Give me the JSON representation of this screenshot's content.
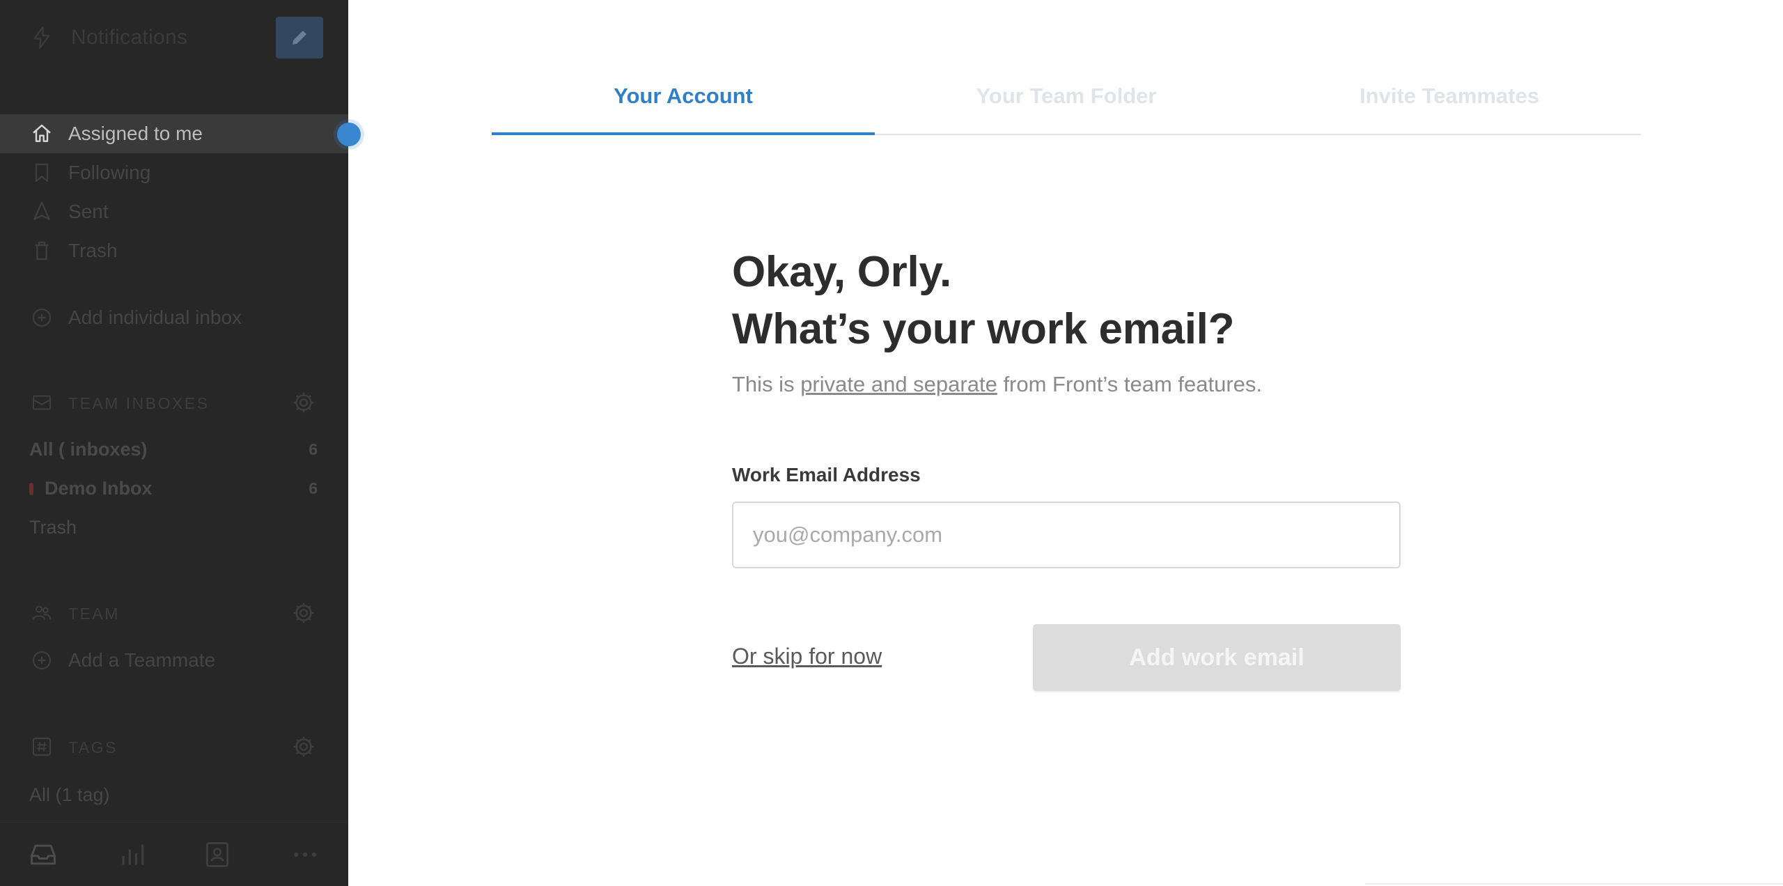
{
  "sidebar": {
    "header_title": "Notifications",
    "nav": [
      {
        "label": "Assigned to me",
        "icon": "home-icon",
        "active": true
      },
      {
        "label": "Following",
        "icon": "bookmark-icon",
        "active": false
      },
      {
        "label": "Sent",
        "icon": "send-icon",
        "active": false
      },
      {
        "label": "Trash",
        "icon": "trash-icon",
        "active": false
      }
    ],
    "add_inbox_label": "Add individual inbox",
    "team_inboxes": {
      "title": "TEAM INBOXES",
      "all_label": "All ( inboxes)",
      "all_count": "6",
      "demo_label": "Demo Inbox",
      "demo_count": "6",
      "trash_label": "Trash"
    },
    "team": {
      "title": "TEAM",
      "add_label": "Add a Teammate"
    },
    "tags": {
      "title": "TAGS",
      "all_label": "All (1 tag)"
    }
  },
  "tabs": [
    {
      "label": "Your Account",
      "active": true
    },
    {
      "label": "Your Team Folder",
      "active": false
    },
    {
      "label": "Invite Teammates",
      "active": false
    }
  ],
  "form": {
    "heading_line1": "Okay, Orly.",
    "heading_line2": "What’s your work email?",
    "sub_prefix": "This is ",
    "sub_link": "private and separate",
    "sub_suffix": " from Front’s team features.",
    "field_label": "Work Email Address",
    "email_value": "",
    "email_placeholder": "you@company.com",
    "skip_label": "Or skip for now",
    "submit_label": "Add work email"
  },
  "colors": {
    "accent": "#2f80c8",
    "sidebar_bg": "#272727",
    "button_disabled": "#dcdcdc"
  }
}
